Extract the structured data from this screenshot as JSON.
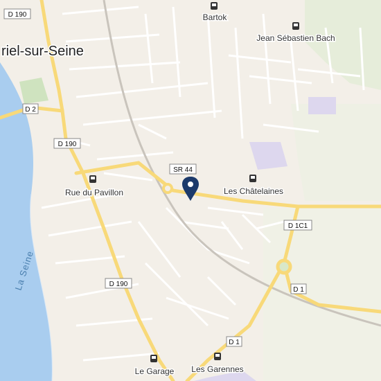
{
  "map": {
    "town_label": "riel-sur-Seine",
    "river_label": "La Seine",
    "places": [
      {
        "name": "Bartok",
        "icon": "bus-stop-icon"
      },
      {
        "name": "Jean Sébastien Bach",
        "icon": "bus-stop-icon"
      },
      {
        "name": "Rue du Pavillon",
        "icon": "bus-stop-icon"
      },
      {
        "name": "Les Châtelaines",
        "icon": "bus-stop-icon"
      },
      {
        "name": "Le Garage",
        "icon": "bus-stop-icon"
      },
      {
        "name": "Les Garennes",
        "icon": "bus-stop-icon"
      }
    ],
    "road_shields": [
      "D 190",
      "D 2",
      "D 190",
      "SR 44",
      "D 1C1",
      "D 190",
      "D 1",
      "D 1"
    ],
    "colors": {
      "land": "#f3efe8",
      "water": "#a9cdef",
      "major_road": "#f8d979",
      "minor_road": "#ffffff",
      "green": "#d9e8c8",
      "pin": "#1c3a6b"
    },
    "marker": {
      "icon": "location-pin-icon"
    }
  }
}
